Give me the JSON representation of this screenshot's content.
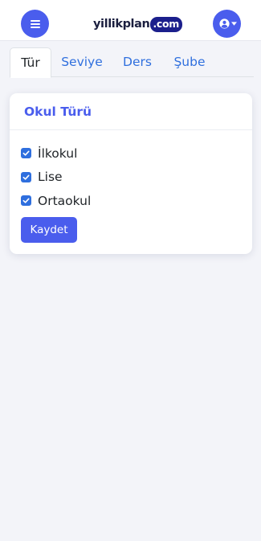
{
  "header": {
    "logo_text": "yillikplan",
    "logo_suffix": ".com",
    "brand_color": "#4a5ded"
  },
  "tabs": [
    {
      "label": "Tür",
      "active": true
    },
    {
      "label": "Seviye",
      "active": false
    },
    {
      "label": "Ders",
      "active": false
    },
    {
      "label": "Şube",
      "active": false
    }
  ],
  "card": {
    "title": "Okul Türü",
    "options": [
      {
        "label": "İlkokul",
        "checked": true
      },
      {
        "label": "Lise",
        "checked": true
      },
      {
        "label": "Ortaokul",
        "checked": true
      }
    ],
    "save_label": "Kaydet"
  },
  "icons": {
    "menu": "hamburger-icon",
    "user": "user-circle-icon",
    "caret": "caret-down-icon",
    "check": "check-icon"
  }
}
